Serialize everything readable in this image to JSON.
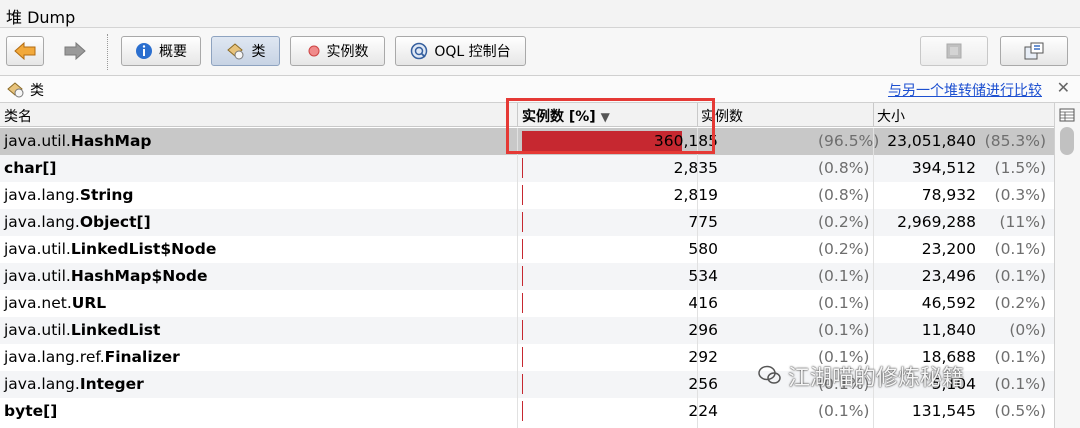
{
  "window": {
    "title": "堆 Dump"
  },
  "toolbar": {
    "back_icon": "arrow-left-icon",
    "forward_icon": "arrow-right-icon",
    "summary_label": "概要",
    "classes_label": "类",
    "instances_label": "实例数",
    "oql_label": "OQL 控制台"
  },
  "panel": {
    "title": "类",
    "compare_link": "与另一个堆转储进行比较"
  },
  "table": {
    "columns": [
      "类名",
      "实例数 [%]",
      "实例数",
      "大小"
    ],
    "sort_indicator": "▼",
    "rows": [
      {
        "pkg": "java.util.",
        "cls": "HashMap",
        "count": "360,185",
        "count_pct": "(96.5%)",
        "bar": 0.965,
        "size": "23,051,840",
        "size_pct": "(85.3%)"
      },
      {
        "pkg": "",
        "cls": "char[]",
        "count": "2,835",
        "count_pct": "(0.8%)",
        "bar": 0.008,
        "size": "394,512",
        "size_pct": "(1.5%)"
      },
      {
        "pkg": "java.lang.",
        "cls": "String",
        "count": "2,819",
        "count_pct": "(0.8%)",
        "bar": 0.008,
        "size": "78,932",
        "size_pct": "(0.3%)"
      },
      {
        "pkg": "java.lang.",
        "cls": "Object[]",
        "count": "775",
        "count_pct": "(0.2%)",
        "bar": 0.002,
        "size": "2,969,288",
        "size_pct": "(11%)"
      },
      {
        "pkg": "java.util.",
        "cls": "LinkedList$Node",
        "count": "580",
        "count_pct": "(0.2%)",
        "bar": 0.002,
        "size": "23,200",
        "size_pct": "(0.1%)"
      },
      {
        "pkg": "java.util.",
        "cls": "HashMap$Node",
        "count": "534",
        "count_pct": "(0.1%)",
        "bar": 0.001,
        "size": "23,496",
        "size_pct": "(0.1%)"
      },
      {
        "pkg": "java.net.",
        "cls": "URL",
        "count": "416",
        "count_pct": "(0.1%)",
        "bar": 0.001,
        "size": "46,592",
        "size_pct": "(0.2%)"
      },
      {
        "pkg": "java.util.",
        "cls": "LinkedList",
        "count": "296",
        "count_pct": "(0.1%)",
        "bar": 0.001,
        "size": "11,840",
        "size_pct": "(0%)"
      },
      {
        "pkg": "java.lang.ref.",
        "cls": "Finalizer",
        "count": "292",
        "count_pct": "(0.1%)",
        "bar": 0.001,
        "size": "18,688",
        "size_pct": "(0.1%)"
      },
      {
        "pkg": "java.lang.",
        "cls": "Integer",
        "count": "256",
        "count_pct": "(0.1%)",
        "bar": 0.001,
        "size": "5,104",
        "size_pct": "(0.1%)"
      },
      {
        "pkg": "",
        "cls": "byte[]",
        "count": "224",
        "count_pct": "(0.1%)",
        "bar": 0.001,
        "size": "131,545",
        "size_pct": "(0.5%)"
      }
    ]
  },
  "watermark": {
    "text": "江湖喵的修炼秘籍"
  },
  "colors": {
    "bar": "#c62830",
    "highlight": "#e53935",
    "link": "#1c4fd0"
  }
}
